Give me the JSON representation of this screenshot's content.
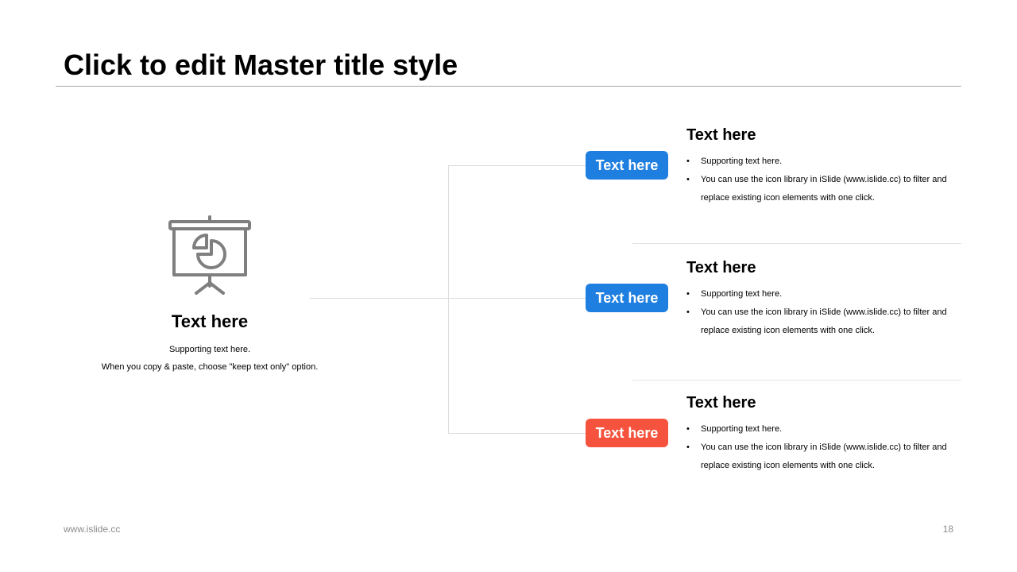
{
  "slide": {
    "title": "Click to edit Master title style",
    "footer_left": "www.islide.cc",
    "page_number": "18"
  },
  "left": {
    "icon": "presentation-board-pie-chart-icon",
    "title": "Text here",
    "line1": "Supporting text here.",
    "line2": "When you copy & paste, choose \"keep text only\" option."
  },
  "items": [
    {
      "tag": "Text here",
      "tag_color": "#1f7fe0",
      "title": "Text here",
      "bullet1": "Supporting text here.",
      "bullet2": "You can use the icon library in iSlide  (www.islide.cc) to filter and replace existing icon elements with one click."
    },
    {
      "tag": "Text here",
      "tag_color": "#1f7fe0",
      "title": "Text here",
      "bullet1": "Supporting text here.",
      "bullet2": "You can use the icon library in iSlide  (www.islide.cc) to filter and replace existing icon elements with one click."
    },
    {
      "tag": "Text here",
      "tag_color": "#f5533d",
      "title": "Text here",
      "bullet1": "Supporting text here.",
      "bullet2": "You can use the icon library in iSlide  (www.islide.cc) to filter and replace existing icon elements with one click."
    }
  ],
  "colors": {
    "accent_blue": "#1f7fe0",
    "accent_red": "#f5533d",
    "icon_gray": "#7f7f7f",
    "rule_gray": "#a6a6a6"
  }
}
